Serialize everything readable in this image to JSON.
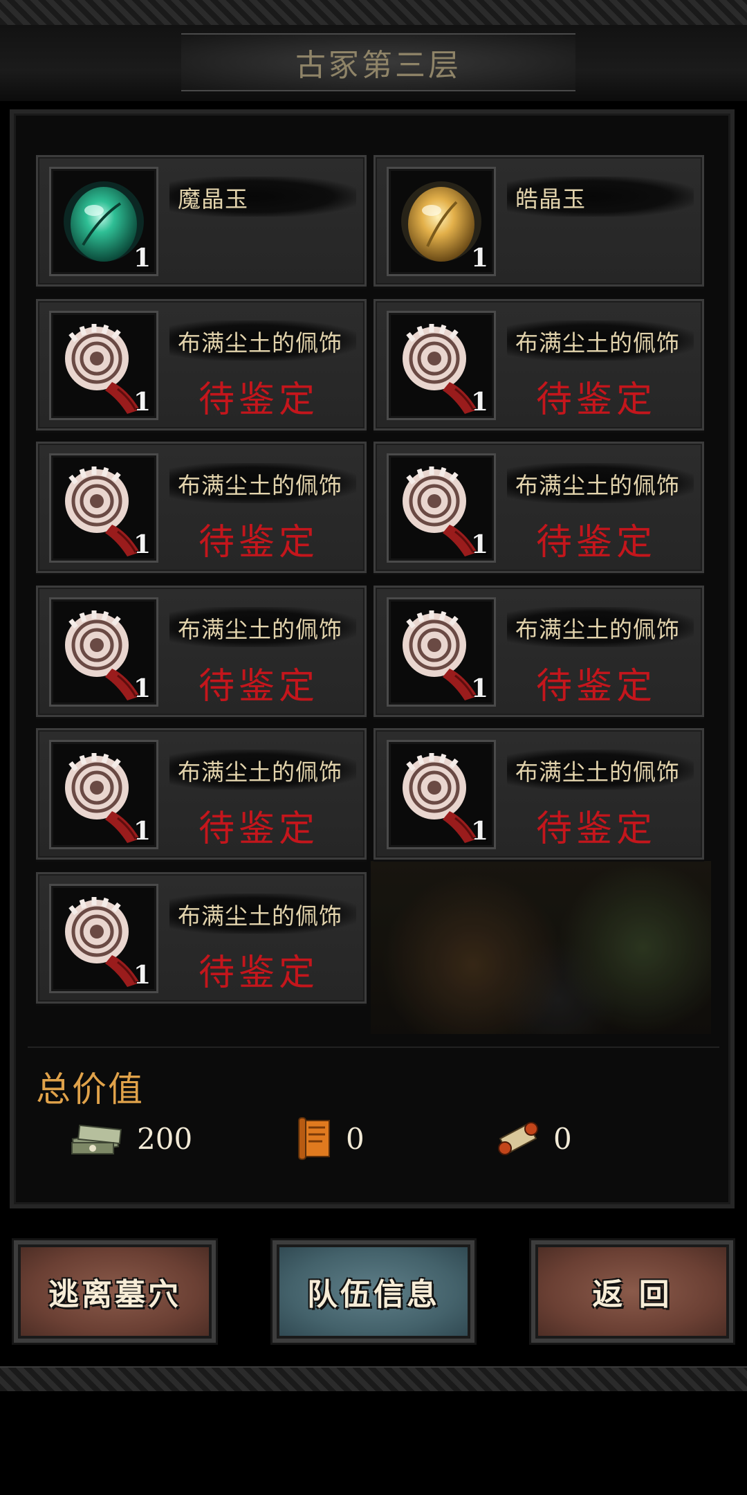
{
  "header": {
    "title": "古冢第三层"
  },
  "loot": {
    "items": [
      {
        "name": "魔晶玉",
        "status": "",
        "count": "1",
        "icon": "green-gem-icon"
      },
      {
        "name": "皓晶玉",
        "status": "",
        "count": "1",
        "icon": "gold-gem-icon"
      },
      {
        "name": "布满尘土的佩饰",
        "status": "待鉴定",
        "count": "1",
        "icon": "bone-trinket-icon"
      },
      {
        "name": "布满尘土的佩饰",
        "status": "待鉴定",
        "count": "1",
        "icon": "bone-trinket-icon"
      },
      {
        "name": "布满尘土的佩饰",
        "status": "待鉴定",
        "count": "1",
        "icon": "bone-trinket-icon"
      },
      {
        "name": "布满尘土的佩饰",
        "status": "待鉴定",
        "count": "1",
        "icon": "bone-trinket-icon"
      },
      {
        "name": "布满尘土的佩饰",
        "status": "待鉴定",
        "count": "1",
        "icon": "bone-trinket-icon"
      },
      {
        "name": "布满尘土的佩饰",
        "status": "待鉴定",
        "count": "1",
        "icon": "bone-trinket-icon"
      },
      {
        "name": "布满尘土的佩饰",
        "status": "待鉴定",
        "count": "1",
        "icon": "bone-trinket-icon"
      },
      {
        "name": "布满尘土的佩饰",
        "status": "待鉴定",
        "count": "1",
        "icon": "bone-trinket-icon"
      },
      {
        "name": "布满尘土的佩饰",
        "status": "待鉴定",
        "count": "1",
        "icon": "bone-trinket-icon"
      }
    ]
  },
  "summary": {
    "label": "总价值",
    "currencies": [
      {
        "icon": "money-stack-icon",
        "value": "200"
      },
      {
        "icon": "orange-scroll-icon",
        "value": "0"
      },
      {
        "icon": "rolled-scroll-icon",
        "value": "0"
      }
    ]
  },
  "buttons": {
    "escape": "逃离墓穴",
    "team_info": "队伍信息",
    "back": "返 回"
  },
  "colors": {
    "status_red": "#c4161c",
    "name_gold": "#e3d4ad",
    "total_orange": "#e0a24a"
  }
}
